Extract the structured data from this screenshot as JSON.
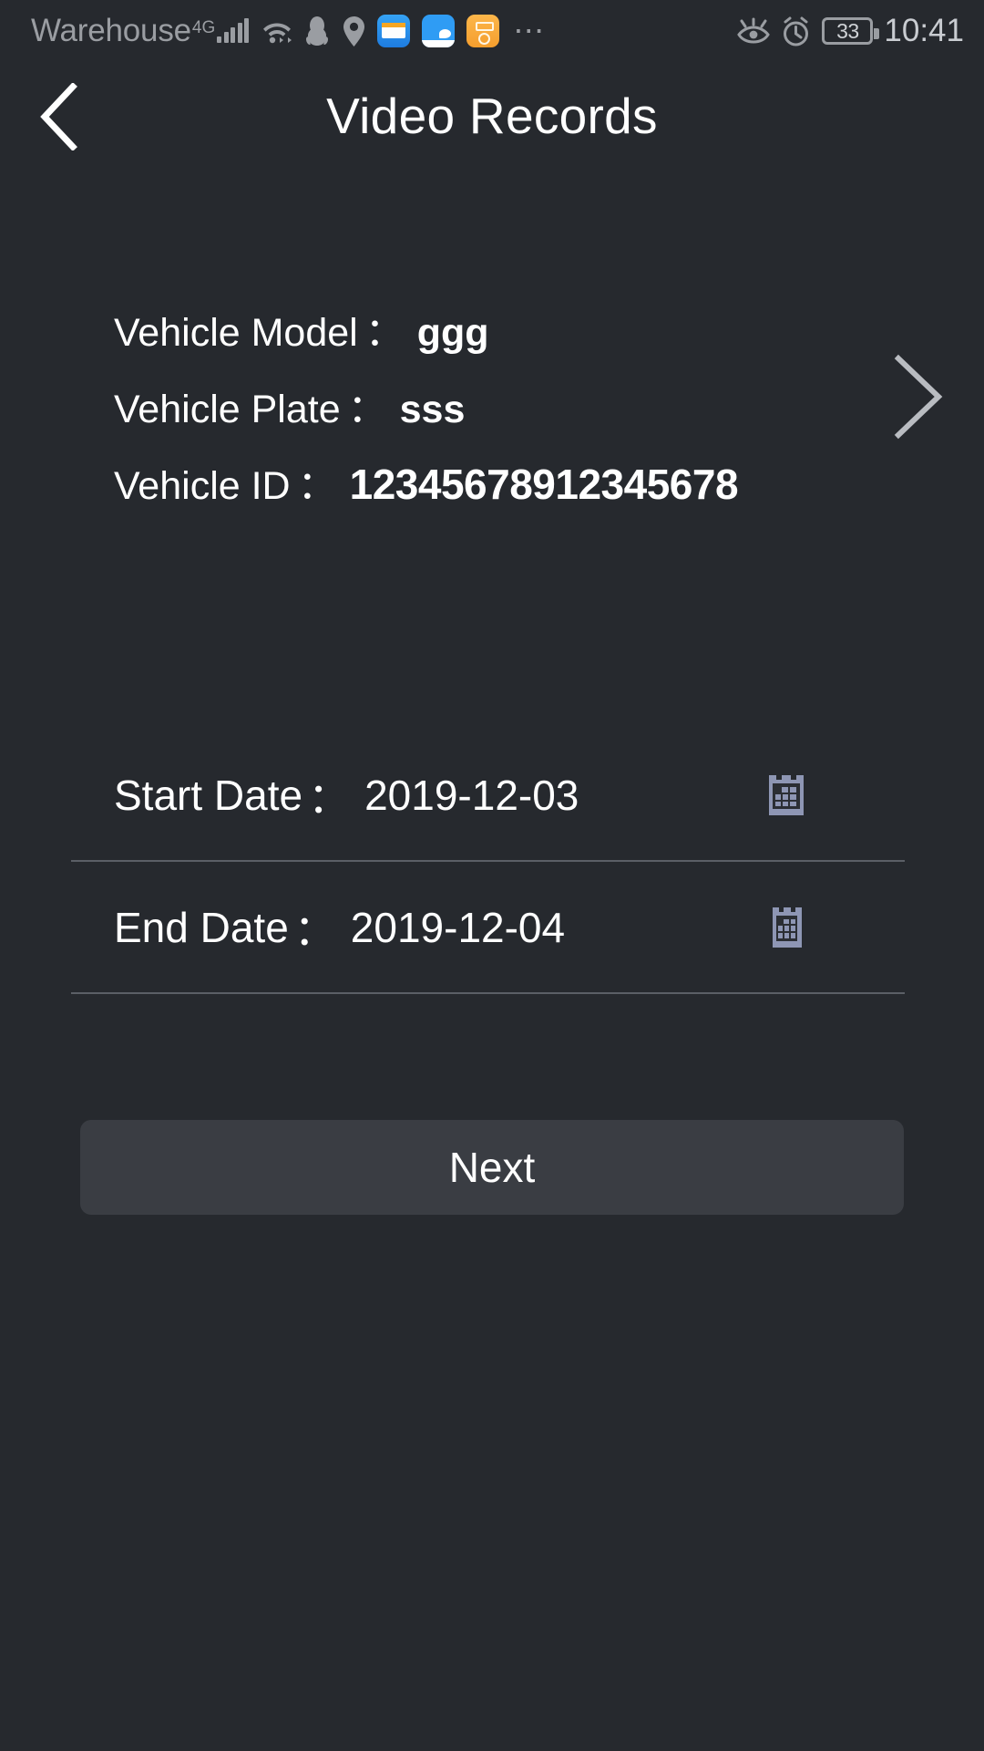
{
  "status_bar": {
    "carrier": "Warehouse",
    "network_type": "4G",
    "signal_icon": "signal-bars-icon",
    "wifi_icon": "wifi-icon",
    "qq_icon": "qq-penguin-icon",
    "location_icon": "location-pin-icon",
    "app_icons": [
      "news-app-icon",
      "chat-app-icon",
      "orange-app-icon"
    ],
    "overflow_icon": "more-dots-icon",
    "eye_comfort_icon": "eye-protection-icon",
    "alarm_icon": "alarm-clock-icon",
    "battery_level": "33",
    "time": "10:41"
  },
  "header": {
    "back_icon": "back-chevron-icon",
    "title": "Video Records"
  },
  "vehicle": {
    "rows": [
      {
        "label": "Vehicle Model",
        "colon": "：",
        "value": "ggg"
      },
      {
        "label": "Vehicle Plate",
        "colon": "：",
        "value": "sss"
      },
      {
        "label": "Vehicle ID",
        "colon": "：",
        "value": "12345678912345678"
      }
    ],
    "chevron_icon": "chevron-right-icon"
  },
  "dates": {
    "start": {
      "label": "Start Date",
      "colon": "：",
      "value": "2019-12-03",
      "calendar_icon": "calendar-icon"
    },
    "end": {
      "label": "End Date",
      "colon": "：",
      "value": "2019-12-04",
      "calendar_icon": "calendar-icon"
    }
  },
  "actions": {
    "next_label": "Next"
  },
  "colors": {
    "background": "#26292e",
    "button": "#3a3d43",
    "text": "#ffffff",
    "muted": "#9a9da2",
    "divider": "#5b5f66",
    "calendar": "#8e96b4"
  }
}
